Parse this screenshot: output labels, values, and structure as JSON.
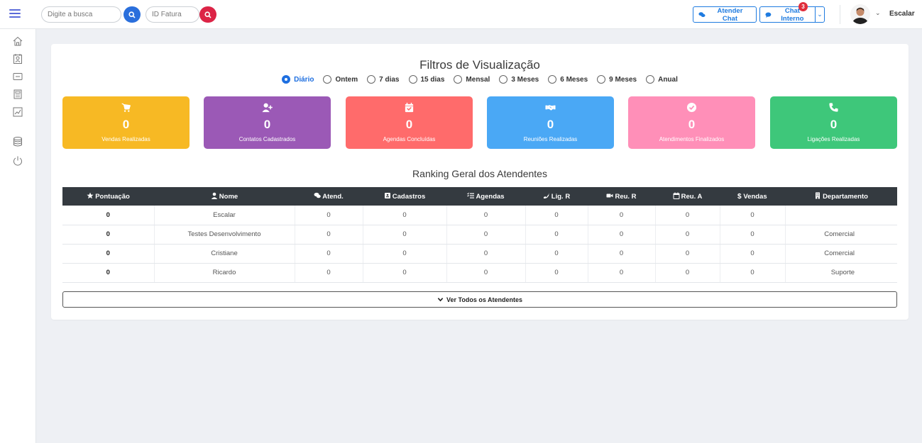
{
  "topbar": {
    "search_placeholder": "Digite a busca",
    "invoice_placeholder": "ID Fatura",
    "atender_chat_label": "Atender Chat",
    "chat_interno_label": "Chat Interno",
    "chat_badge_count": "3",
    "user_name": "Escalar"
  },
  "sidebar": {
    "items": [
      "home-icon",
      "contacts-icon",
      "message-icon",
      "calculator-icon",
      "chart-icon",
      "database-icon",
      "power-icon"
    ]
  },
  "main": {
    "title": "Filtros de Visualização",
    "filters": [
      {
        "label": "Diário",
        "checked": true
      },
      {
        "label": "Ontem",
        "checked": false
      },
      {
        "label": "7 dias",
        "checked": false
      },
      {
        "label": "15 dias",
        "checked": false
      },
      {
        "label": "Mensal",
        "checked": false
      },
      {
        "label": "3 Meses",
        "checked": false
      },
      {
        "label": "6 Meses",
        "checked": false
      },
      {
        "label": "9 Meses",
        "checked": false
      },
      {
        "label": "Anual",
        "checked": false
      }
    ],
    "stats": [
      {
        "value": "0",
        "label": "Vendas Realizadas",
        "color": "#f7b924",
        "icon": "cart-icon"
      },
      {
        "value": "0",
        "label": "Contatos Cadastrados",
        "color": "#9b59b6",
        "icon": "user-plus-icon"
      },
      {
        "value": "0",
        "label": "Agendas Concluídas",
        "color": "#ff6b6b",
        "icon": "calendar-check-icon"
      },
      {
        "value": "0",
        "label": "Reuniões Realizadas",
        "color": "#4aa8f5",
        "icon": "handshake-icon"
      },
      {
        "value": "0",
        "label": "Atendimentos Finalizados",
        "color": "#ff8fb8",
        "icon": "check-circle-icon"
      },
      {
        "value": "0",
        "label": "Ligações Realizadas",
        "color": "#3ec77a",
        "icon": "phone-icon"
      }
    ],
    "ranking_title": "Ranking Geral dos Atendentes",
    "table": {
      "headers": [
        "Pontuação",
        "Nome",
        "Atend.",
        "Cadastros",
        "Agendas",
        "Lig. R",
        "Reu. R",
        "Reu. A",
        "Vendas",
        "Departamento"
      ],
      "rows": [
        [
          "0",
          "Escalar",
          "0",
          "0",
          "0",
          "0",
          "0",
          "0",
          "0",
          ""
        ],
        [
          "0",
          "Testes Desenvolvimento",
          "0",
          "0",
          "0",
          "0",
          "0",
          "0",
          "0",
          "Comercial"
        ],
        [
          "0",
          "Cristiane",
          "0",
          "0",
          "0",
          "0",
          "0",
          "0",
          "0",
          "Comercial"
        ],
        [
          "0",
          "Ricardo",
          "0",
          "0",
          "0",
          "0",
          "0",
          "0",
          "0",
          "Suporte"
        ]
      ]
    },
    "see_all_label": "Ver Todos os Atendentes"
  }
}
